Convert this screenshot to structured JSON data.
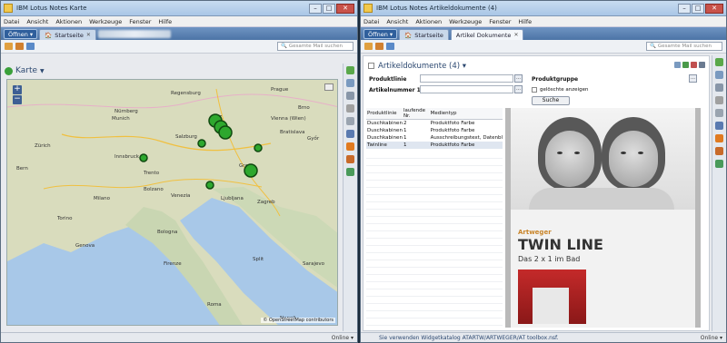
{
  "left_window": {
    "title": "IBM Lotus Notes Karte",
    "menu": [
      "Datei",
      "Ansicht",
      "Aktionen",
      "Werkzeuge",
      "Fenster",
      "Hilfe"
    ],
    "open_btn": "Öffnen ▾",
    "tabs": [
      {
        "label": "Startseite"
      }
    ],
    "search_placeholder": "Gesamte Mail suchen",
    "view_title": "Karte",
    "status": "Online ▾",
    "map": {
      "labels": [
        {
          "t": "Regensburg"
        },
        {
          "t": "Prague"
        },
        {
          "t": "Brno"
        },
        {
          "t": "Nürnberg"
        },
        {
          "t": "Linz"
        },
        {
          "t": "Munich"
        },
        {
          "t": "Vienna (Wien)"
        },
        {
          "t": "Salzburg"
        },
        {
          "t": "Innsbruck"
        },
        {
          "t": "Graz"
        },
        {
          "t": "Ljubljana"
        },
        {
          "t": "Zagreb"
        },
        {
          "t": "Bolzano"
        },
        {
          "t": "Venezia"
        },
        {
          "t": "Milano"
        },
        {
          "t": "Torino"
        },
        {
          "t": "Genova"
        },
        {
          "t": "Bologna"
        },
        {
          "t": "Firenze"
        },
        {
          "t": "Roma"
        },
        {
          "t": "Napoli"
        },
        {
          "t": "Sarajevo"
        },
        {
          "t": "Split"
        },
        {
          "t": "Győr"
        },
        {
          "t": "Bratislava"
        },
        {
          "t": "Zürich"
        },
        {
          "t": "Trento"
        },
        {
          "t": "Bern"
        }
      ],
      "markers": [
        {
          "size": "large"
        },
        {
          "size": "large"
        },
        {
          "size": "large"
        },
        {
          "size": "small"
        },
        {
          "size": "small"
        },
        {
          "size": "small"
        },
        {
          "size": "large"
        },
        {
          "size": "small"
        }
      ],
      "attribution": "© OpenStreetMap contributors"
    }
  },
  "right_window": {
    "title": "IBM Lotus Notes Artikeldokumente (4)",
    "menu": [
      "Datei",
      "Ansicht",
      "Aktionen",
      "Werkzeuge",
      "Fenster",
      "Hilfe"
    ],
    "open_btn": "Öffnen ▾",
    "tabs": [
      {
        "label": "Startseite"
      },
      {
        "label": "Artikel Dokumente"
      }
    ],
    "search_placeholder": "Gesamte Mail suchen",
    "view_title": "Artikeldokumente (4) ▾",
    "form": {
      "produktlinie_label": "Produktlinie",
      "artikelnummer_label": "Artikelnummer 1:",
      "produktgruppe_label": "Produktgruppe",
      "geloeschte_label": "gelöschte anzeigen",
      "suche_label": "Suche"
    },
    "table": {
      "headers": [
        "Produktlinie",
        "laufende Nr.",
        "Medientyp"
      ],
      "rows": [
        [
          "Duschkabinen",
          "2",
          "Produktfoto Farbe"
        ],
        [
          "Duschkabinen",
          "1",
          "Produktfoto Farbe"
        ],
        [
          "Duschkabinen",
          "1",
          "Ausschreibungstext, Datenbl"
        ],
        [
          "Twinline",
          "1",
          "Produktfoto Farbe"
        ]
      ]
    },
    "preview": {
      "brand": "Artweger",
      "product": "TWIN LINE",
      "subtitle": "Das 2 x 1 im Bad"
    },
    "status_text": "Sie verwenden Widgetkatalog ATARTW/ARTWEGER/AT toolbox.nsf.",
    "status": "Online ▾"
  },
  "colors": {
    "accent": "#4c74a6",
    "marker": "#2ea82e",
    "link": "#2c4870"
  }
}
